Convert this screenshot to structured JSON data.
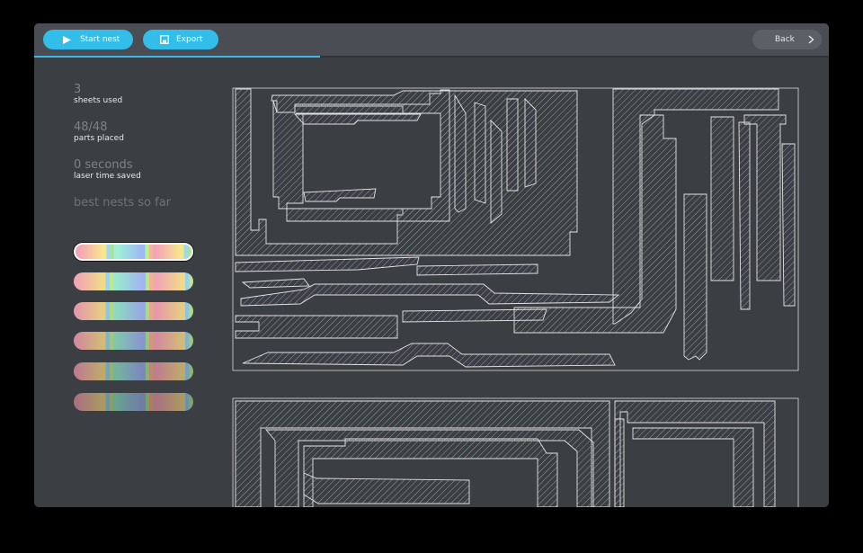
{
  "toolbar": {
    "start_label": "Start nest",
    "start_icon": "play-icon",
    "export_label": "Export",
    "export_icon": "save-icon",
    "back_label": "Back",
    "back_icon": "chevron-right-icon",
    "accent_color": "#33bde9"
  },
  "progress": {
    "fraction": 0.36
  },
  "stats": {
    "sheets_value": "3",
    "sheets_label": "sheets used",
    "parts_value": "48/48",
    "parts_label": "parts placed",
    "laser_value": "0 seconds",
    "laser_label": "laser time saved",
    "nests_heading": "best nests so far"
  },
  "nests": [
    {
      "selected": true,
      "palette": [
        "#f3a5b8",
        "#a6e3a0",
        "#9fd8f2",
        "#f7e58c",
        "#c6a9f2",
        "#9ef0d7",
        "#f4b98a",
        "#b7f0a3",
        "#a0b9f5",
        "#f2a8e3"
      ]
    },
    {
      "selected": false,
      "palette": [
        "#f0a6b4",
        "#bfe59a",
        "#98d4ef",
        "#f1d98a",
        "#c4a3ee",
        "#96e8cf",
        "#f0b48c",
        "#aee79d",
        "#a3b5f1",
        "#eaa2dc"
      ]
    },
    {
      "selected": false,
      "palette": [
        "#e69aa9",
        "#b1d98e",
        "#8ec6e2",
        "#e5cc83",
        "#b899df",
        "#8dd9c1",
        "#e3a884",
        "#a3d992",
        "#97a9e3",
        "#dc99ce"
      ]
    },
    {
      "selected": false,
      "palette": [
        "#d28c9b",
        "#9fc781",
        "#80b4cf",
        "#d2ba77",
        "#a78acb",
        "#80c5af",
        "#cf9878",
        "#94c585",
        "#8898cf",
        "#c98bbb"
      ]
    },
    {
      "selected": false,
      "palette": [
        "#be7f8c",
        "#90b475",
        "#74a3bb",
        "#bea96c",
        "#977cb7",
        "#74b29f",
        "#bb8a6c",
        "#85b278",
        "#7b8abb",
        "#b57ea9"
      ]
    },
    {
      "selected": false,
      "palette": [
        "#a97380",
        "#82a26a",
        "#6993a8",
        "#ab9862",
        "#8870a5",
        "#69a090",
        "#a87d62",
        "#78a06d",
        "#6f7da8",
        "#a37299"
      ]
    }
  ]
}
